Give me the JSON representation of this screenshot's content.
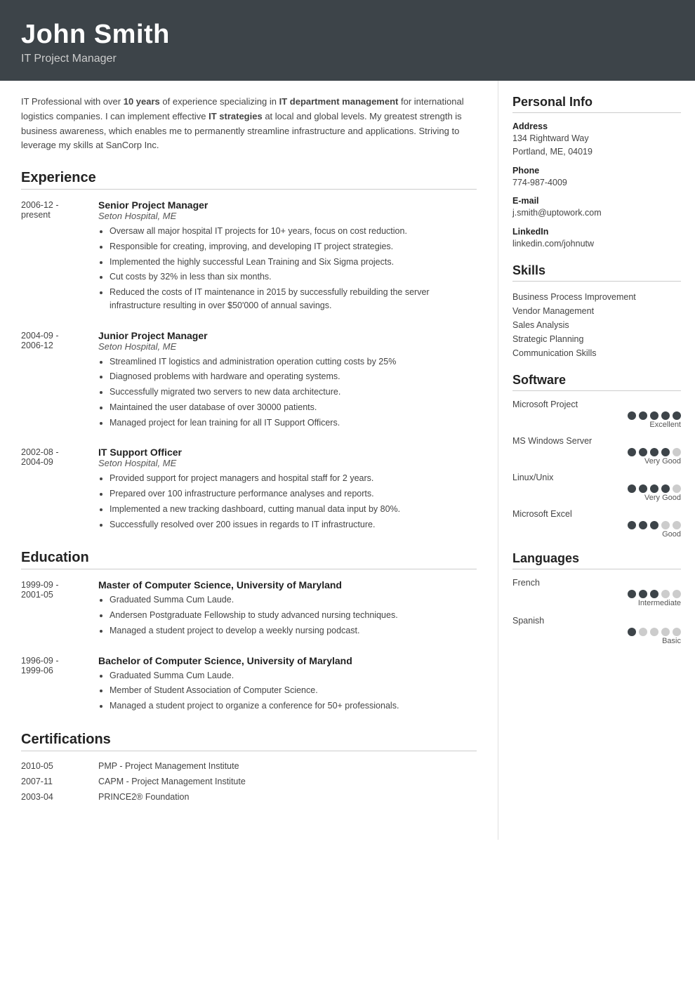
{
  "header": {
    "name": "John Smith",
    "title": "IT Project Manager"
  },
  "summary": {
    "text_parts": [
      "IT Professional with over ",
      "10 years",
      " of experience specializing in ",
      "IT department management",
      " for international logistics companies. I can implement effective ",
      "IT strategies",
      " at local and global levels. My greatest strength is business awareness, which enables me to permanently streamline infrastructure and applications. Striving to leverage my skills at SanCorp Inc."
    ]
  },
  "sections": {
    "experience_label": "Experience",
    "education_label": "Education",
    "certifications_label": "Certifications"
  },
  "experience": [
    {
      "date_start": "2006-12 -",
      "date_end": "present",
      "title": "Senior Project Manager",
      "company": "Seton Hospital, ME",
      "bullets": [
        "Oversaw all major hospital IT projects for 10+ years, focus on cost reduction.",
        "Responsible for creating, improving, and developing IT project strategies.",
        "Implemented the highly successful Lean Training and Six Sigma projects.",
        "Cut costs by 32% in less than six months.",
        "Reduced the costs of IT maintenance in 2015 by successfully rebuilding the server infrastructure resulting in over $50'000 of annual savings."
      ]
    },
    {
      "date_start": "2004-09 -",
      "date_end": "2006-12",
      "title": "Junior Project Manager",
      "company": "Seton Hospital, ME",
      "bullets": [
        "Streamlined IT logistics and administration operation cutting costs by 25%",
        "Diagnosed problems with hardware and operating systems.",
        "Successfully migrated two servers to new data architecture.",
        "Maintained the user database of over 30000 patients.",
        "Managed project for lean training for all IT Support Officers."
      ]
    },
    {
      "date_start": "2002-08 -",
      "date_end": "2004-09",
      "title": "IT Support Officer",
      "company": "Seton Hospital, ME",
      "bullets": [
        "Provided support for project managers and hospital staff for 2 years.",
        "Prepared over 100 infrastructure performance analyses and reports.",
        "Implemented a new tracking dashboard, cutting manual data input by 80%.",
        "Successfully resolved over 200 issues in regards to IT infrastructure."
      ]
    }
  ],
  "education": [
    {
      "date_start": "1999-09 -",
      "date_end": "2001-05",
      "title": "Master of Computer Science, University of Maryland",
      "bullets": [
        "Graduated Summa Cum Laude.",
        "Andersen Postgraduate Fellowship to study advanced nursing techniques.",
        "Managed a student project to develop a weekly nursing podcast."
      ]
    },
    {
      "date_start": "1996-09 -",
      "date_end": "1999-06",
      "title": "Bachelor of Computer Science, University of Maryland",
      "bullets": [
        "Graduated Summa Cum Laude.",
        "Member of Student Association of Computer Science.",
        "Managed a student project to organize a conference for 50+ professionals."
      ]
    }
  ],
  "certifications": [
    {
      "date": "2010-05",
      "name": "PMP - Project Management Institute"
    },
    {
      "date": "2007-11",
      "name": "CAPM - Project Management Institute"
    },
    {
      "date": "2003-04",
      "name": "PRINCE2® Foundation"
    }
  ],
  "personal_info": {
    "title": "Personal Info",
    "address_label": "Address",
    "address_value": "134 Rightward Way\nPortland, ME, 04019",
    "phone_label": "Phone",
    "phone_value": "774-987-4009",
    "email_label": "E-mail",
    "email_value": "j.smith@uptowork.com",
    "linkedin_label": "LinkedIn",
    "linkedin_value": "linkedin.com/johnutw"
  },
  "skills": {
    "title": "Skills",
    "items": [
      "Business Process Improvement",
      "Vendor Management",
      "Sales Analysis",
      "Strategic Planning",
      "Communication Skills"
    ]
  },
  "software": {
    "title": "Software",
    "items": [
      {
        "name": "Microsoft Project",
        "filled": 5,
        "total": 5,
        "label": "Excellent"
      },
      {
        "name": "MS Windows Server",
        "filled": 4,
        "total": 5,
        "label": "Very Good"
      },
      {
        "name": "Linux/Unix",
        "filled": 4,
        "total": 5,
        "label": "Very Good"
      },
      {
        "name": "Microsoft Excel",
        "filled": 3,
        "total": 5,
        "label": "Good"
      }
    ]
  },
  "languages": {
    "title": "Languages",
    "items": [
      {
        "name": "French",
        "filled": 3,
        "total": 5,
        "label": "Intermediate"
      },
      {
        "name": "Spanish",
        "filled": 1,
        "total": 5,
        "label": "Basic"
      }
    ]
  }
}
